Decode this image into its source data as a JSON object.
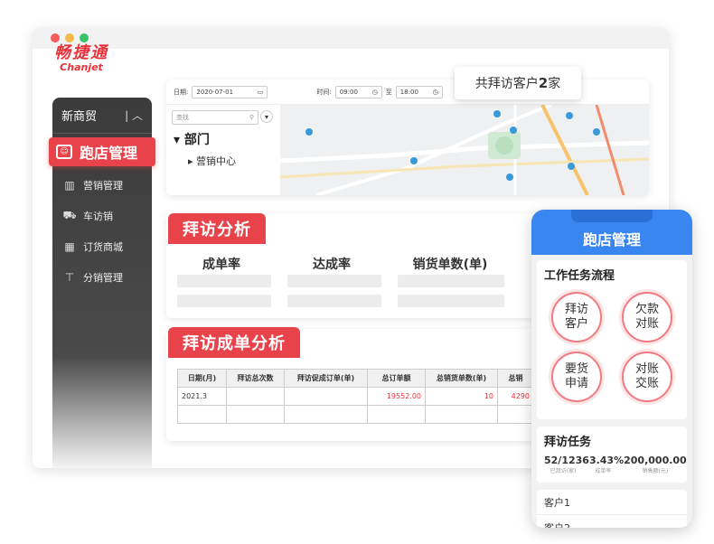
{
  "window": {
    "dots": [
      "#f45b5b",
      "#f7b84b",
      "#3ac26a"
    ]
  },
  "logo": {
    "cn": "畅捷通",
    "en": "Chanjet"
  },
  "sidebar": {
    "header": "新商贸",
    "active": "跑店管理",
    "items": [
      {
        "label": "营销管理",
        "icon": "bar-chart-icon"
      },
      {
        "label": "车访销",
        "icon": "car-icon"
      },
      {
        "label": "订货商城",
        "icon": "store-icon"
      },
      {
        "label": "分销管理",
        "icon": "hierarchy-icon"
      }
    ]
  },
  "filter": {
    "date_label": "日期:",
    "date_value": "2020-07-01",
    "time_label": "时间:",
    "time_from": "09:00",
    "to_label": "至",
    "time_to": "18:00"
  },
  "tree": {
    "search_placeholder": "查找",
    "department": "部门",
    "sub": "营销中心"
  },
  "map_bubble": {
    "prefix": "共拜访客户",
    "count": "2",
    "suffix": "家"
  },
  "visit_analysis": {
    "title": "拜访分析",
    "metrics": [
      "成单率",
      "达成率",
      "销货单数(单)"
    ]
  },
  "order_analysis": {
    "title": "拜访成单分析",
    "headers": [
      "日期(月)",
      "拜访总次数",
      "拜访促成订单(单)",
      "总订单额",
      "总销货单数(单)",
      "总销"
    ],
    "rows": [
      [
        "2021.3",
        "",
        "",
        "19552.00",
        "10",
        "4290"
      ],
      [
        "",
        "",
        "",
        "",
        "",
        ""
      ]
    ]
  },
  "phone": {
    "title": "跑店管理",
    "workflow_title": "工作任务流程",
    "workflow": [
      {
        "line1": "拜访",
        "line2": "客户"
      },
      {
        "line1": "欠款",
        "line2": "对账"
      },
      {
        "line1": "要货",
        "line2": "申请"
      },
      {
        "line1": "对账",
        "line2": "交账"
      }
    ],
    "task_title": "拜访任务",
    "stats": [
      {
        "value": "52/123",
        "label": "已拜访(家)"
      },
      {
        "value": "63.43%",
        "label": "成单率"
      },
      {
        "value": "200,000.00",
        "label": "销售额(元)"
      }
    ],
    "customers": [
      "客户1",
      "客户2"
    ]
  },
  "colors": {
    "accent": "#e8434a",
    "phone_blue": "#3a86f0"
  }
}
